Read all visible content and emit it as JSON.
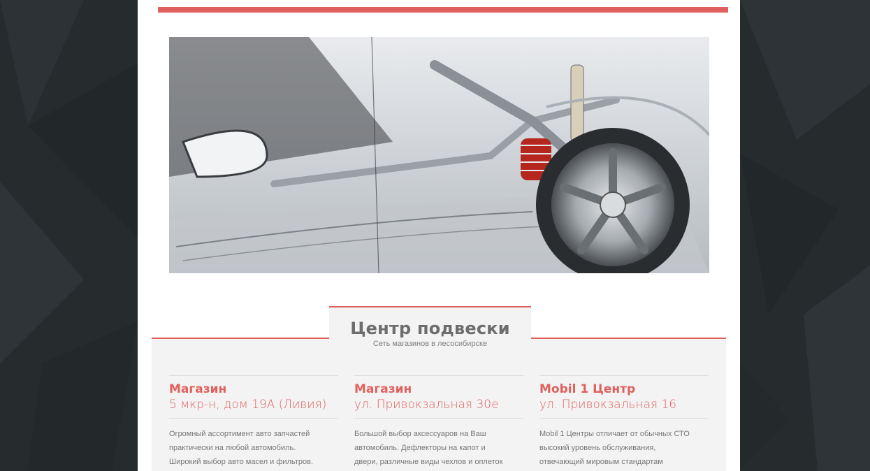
{
  "section": {
    "title": "Центр подвески",
    "subtitle": "Сеть магазинов в лесосибирске"
  },
  "cards": [
    {
      "title": "Магазин",
      "address": "5 мкр-н, дом 19А (Ливия)",
      "text_lines": [
        "Огромный ассортимент авто запчастей",
        "практически на любой автомобиль.",
        "Широкий выбор авто масел и фильтров."
      ]
    },
    {
      "title": "Магазин",
      "address": "ул. Привокзальная 30е",
      "text_lines": [
        "Большой выбор аксессуаров на Ваш",
        "автомобиль. Дефлекторы на капот и",
        "двери, различные виды чехлов и оплеток"
      ]
    },
    {
      "title": "Mobil 1 Центр",
      "address": "ул. Привокзальная 16",
      "text_lines": [
        "Mobil 1 Центры отличает от обычных СТО",
        "высокий уровень обслуживания,",
        "отвечающий мировым стандартам"
      ]
    }
  ],
  "colors": {
    "accent": "#e0605e",
    "background": "#262b2e",
    "section_bg": "#f3f3f3",
    "title_gray": "#6d6d6d"
  },
  "icons": {
    "hero": "car-suspension-image"
  }
}
